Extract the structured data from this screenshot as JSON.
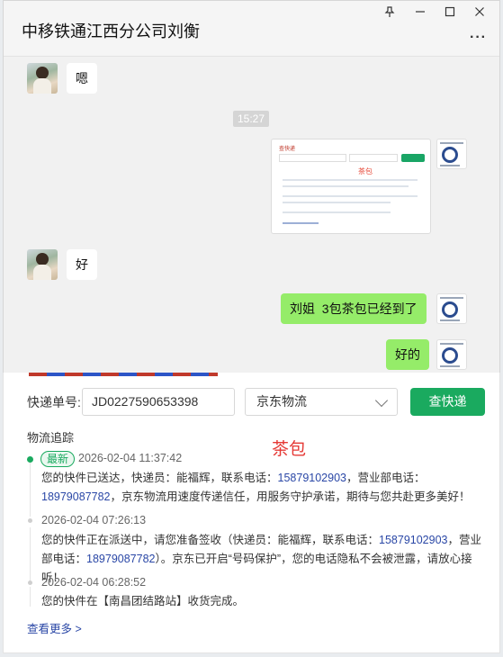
{
  "window": {
    "title": "中移铁通江西分公司刘衡",
    "pin_icon": "pin-icon",
    "minimize_icon": "minimize-icon",
    "maximize_icon": "maximize-icon",
    "close_icon": "close-icon",
    "more_icon": "more-icon"
  },
  "chat": {
    "messages": [
      {
        "side": "left",
        "text": "嗯"
      },
      {
        "side": "center",
        "text": "15:27"
      },
      {
        "side": "right",
        "type": "image",
        "caption": "茶包"
      },
      {
        "side": "left",
        "text": "好"
      },
      {
        "side": "right",
        "text": "刘姐  3包茶包已经到了"
      },
      {
        "side": "right",
        "text": "好的"
      }
    ],
    "thumb": {
      "title": "查快递",
      "red": "茶包"
    }
  },
  "tracking": {
    "label_number": "快递单号:",
    "tracking_number": "JD0227590653398",
    "carrier": "京东物流",
    "query_button": "查快递",
    "section_title": "物流追踪",
    "red_label": "茶包",
    "events": [
      {
        "badge": "最新",
        "time": "2026-02-04 11:37:42",
        "text_a": "您的快件已送达，快递员：能福辉，联系电话：",
        "phone_a": "15879102903",
        "text_b": "，营业部电话：",
        "phone_b": "18979087782",
        "text_c": "，京东物流用速度传递信任，用服务守护承诺，期待与您共赴更多美好！"
      },
      {
        "time": "2026-02-04 07:26:13",
        "text_a": "您的快件正在派送中，请您准备签收（快递员：能福辉，联系电话：",
        "phone_a": "15879102903",
        "text_b": "，营业部电话：",
        "phone_b": "18979087782",
        "text_c": "）。京东已开启“号码保护”，您的电话隐私不会被泄露，请放心接听！"
      },
      {
        "time": "2026-02-04 06:28:52",
        "text": "您的快件在【南昌团结路站】收货完成。"
      }
    ],
    "see_more": "查看更多 >"
  },
  "colors": {
    "bubble_green": "#95ec69",
    "brand_green": "#1aaa5f",
    "link_blue": "#2a47a6",
    "accent_red": "#e53935"
  }
}
